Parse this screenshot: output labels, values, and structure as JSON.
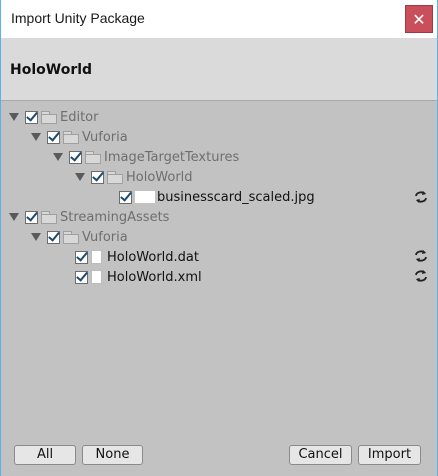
{
  "window": {
    "title": "Import Unity Package",
    "close_glyph": "✕"
  },
  "package": {
    "name": "HoloWorld"
  },
  "tree": {
    "editor": "Editor",
    "editor_vuforia": "Vuforia",
    "image_target_textures": "ImageTargetTextures",
    "holoworld_folder": "HoloWorld",
    "businesscard_file": "businesscard_scaled.jpg",
    "streaming_assets": "StreamingAssets",
    "streaming_vuforia": "Vuforia",
    "dat_file": "HoloWorld.dat",
    "xml_file": "HoloWorld.xml"
  },
  "buttons": {
    "all": "All",
    "none": "None",
    "cancel": "Cancel",
    "import": "Import"
  }
}
